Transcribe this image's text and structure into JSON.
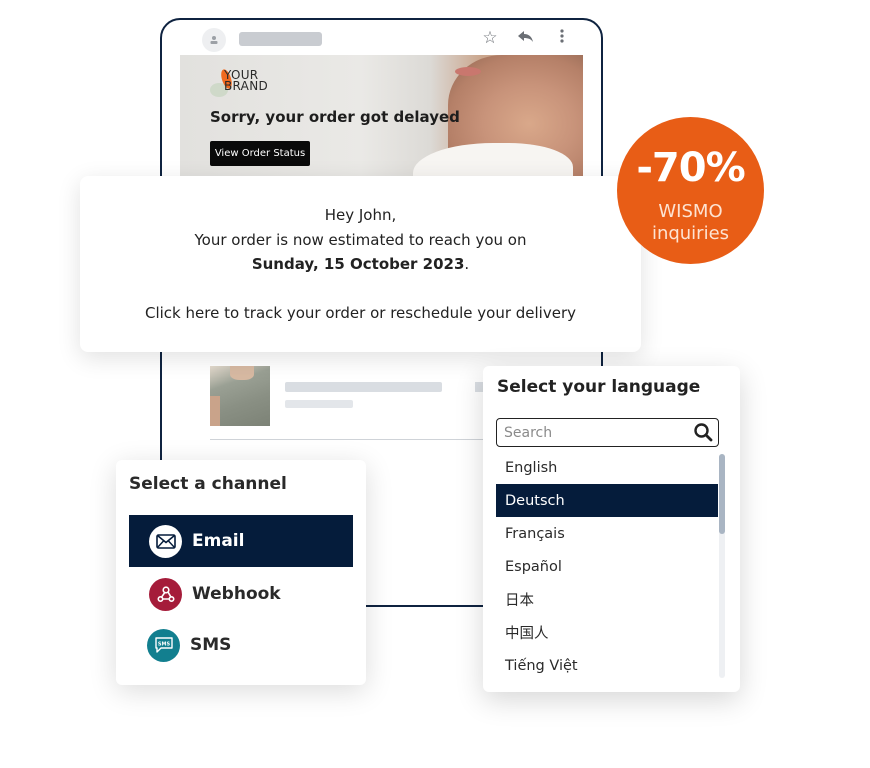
{
  "email_preview": {
    "top_icons": [
      "star-icon",
      "reply-icon",
      "more-vertical-icon"
    ],
    "brand_line1": "YOUR",
    "brand_line2": "BRAND",
    "banner_title": "Sorry, your order got delayed",
    "banner_button": "View Order Status"
  },
  "message": {
    "greeting": "Hey John,",
    "line2": "Your order is now estimated to reach you on",
    "date": "Sunday, 15 October 2023",
    "date_suffix": ".",
    "cta": "Click here to track your order or reschedule your delivery"
  },
  "badge": {
    "value": "-70%",
    "line1": "WISMO",
    "line2": "inquiries",
    "color": "#e85d16"
  },
  "channel_select": {
    "title": "Select a channel",
    "selected": "Email",
    "items": [
      {
        "label": "Email",
        "icon": "envelope-icon",
        "color": "#ffffff"
      },
      {
        "label": "Webhook",
        "icon": "webhook-icon",
        "color": "#a51c3a"
      },
      {
        "label": "SMS",
        "icon": "sms-icon",
        "color": "#127f8f"
      }
    ]
  },
  "language_select": {
    "title": "Select your language",
    "search_placeholder": "Search",
    "search_value": "",
    "selected": "Deutsch",
    "items": [
      "English",
      "Deutsch",
      "Français",
      "Español",
      "日本",
      "中国人",
      "Tiếng Việt"
    ]
  },
  "colors": {
    "navy": "#051c3b",
    "accent_orange": "#e85d16"
  }
}
